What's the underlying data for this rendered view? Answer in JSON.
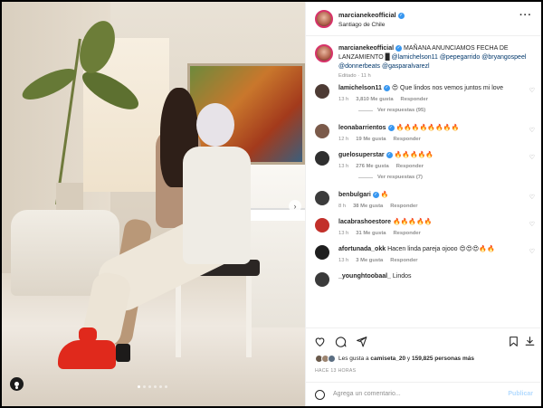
{
  "colors": {
    "accent": "#3897f0",
    "text": "#262626",
    "muted": "#8e8e8e",
    "post_disabled": "#b3dbff"
  },
  "post": {
    "author": "marcianekeofficial",
    "location": "Santiago de Chile",
    "more_icon": "more-horizontal-icon"
  },
  "caption": {
    "author": "marcianekeofficial",
    "text": "MAÑANA ANUNCIAMOS FECHA DE LANZAMIENTO",
    "block": "█",
    "mentions": [
      "@lamichelson11",
      "@pepegarrido",
      "@bryangospeel",
      "@donnerbeats",
      "@gasparalvarezl"
    ],
    "edited": "Editado",
    "time": "11 h"
  },
  "comments": [
    {
      "user": "lamichelson11",
      "verified": true,
      "text": "😍 Que lindos nos vemos juntos mi love",
      "time": "13 h",
      "likes": "3,810 Me gusta",
      "reply": "Responder",
      "replies": "Ver respuestas (95)"
    },
    {
      "user": "leonabarrientos",
      "verified": true,
      "text": "🔥🔥🔥🔥🔥🔥🔥🔥",
      "time": "12 h",
      "likes": "19 Me gusta",
      "reply": "Responder"
    },
    {
      "user": "guelosuperstar",
      "verified": true,
      "text": "🔥🔥🔥🔥🔥",
      "time": "13 h",
      "likes": "276 Me gusta",
      "reply": "Responder",
      "replies": "Ver respuestas (7)"
    },
    {
      "user": "benbulgari",
      "verified": true,
      "text": "🔥",
      "time": "8 h",
      "likes": "38 Me gusta",
      "reply": "Responder"
    },
    {
      "user": "lacabrashoestore",
      "verified": false,
      "text": "🔥🔥🔥🔥🔥",
      "time": "13 h",
      "likes": "31 Me gusta",
      "reply": "Responder"
    },
    {
      "user": "afortunada_okk",
      "verified": false,
      "text": "Hacen linda pareja ojooo 😍😍😍🔥🔥",
      "time": "13 h",
      "likes": "3 Me gusta",
      "reply": "Responder"
    },
    {
      "user": "_younghtoobaal_",
      "verified": false,
      "text": "Lindos",
      "time": "",
      "likes": "",
      "reply": ""
    }
  ],
  "actions": {
    "like_icon": "heart-icon",
    "comment_icon": "comment-icon",
    "share_icon": "share-icon",
    "save_icon": "bookmark-icon",
    "download_icon": "download-icon"
  },
  "likes": {
    "prefix": "Les gusta a",
    "user": "camiseta_20",
    "middle": "y",
    "count": "159,825 personas más"
  },
  "timestamp": "HACE 13 HORAS",
  "add_comment": {
    "placeholder": "Agrega un comentario...",
    "post_label": "Publicar"
  }
}
